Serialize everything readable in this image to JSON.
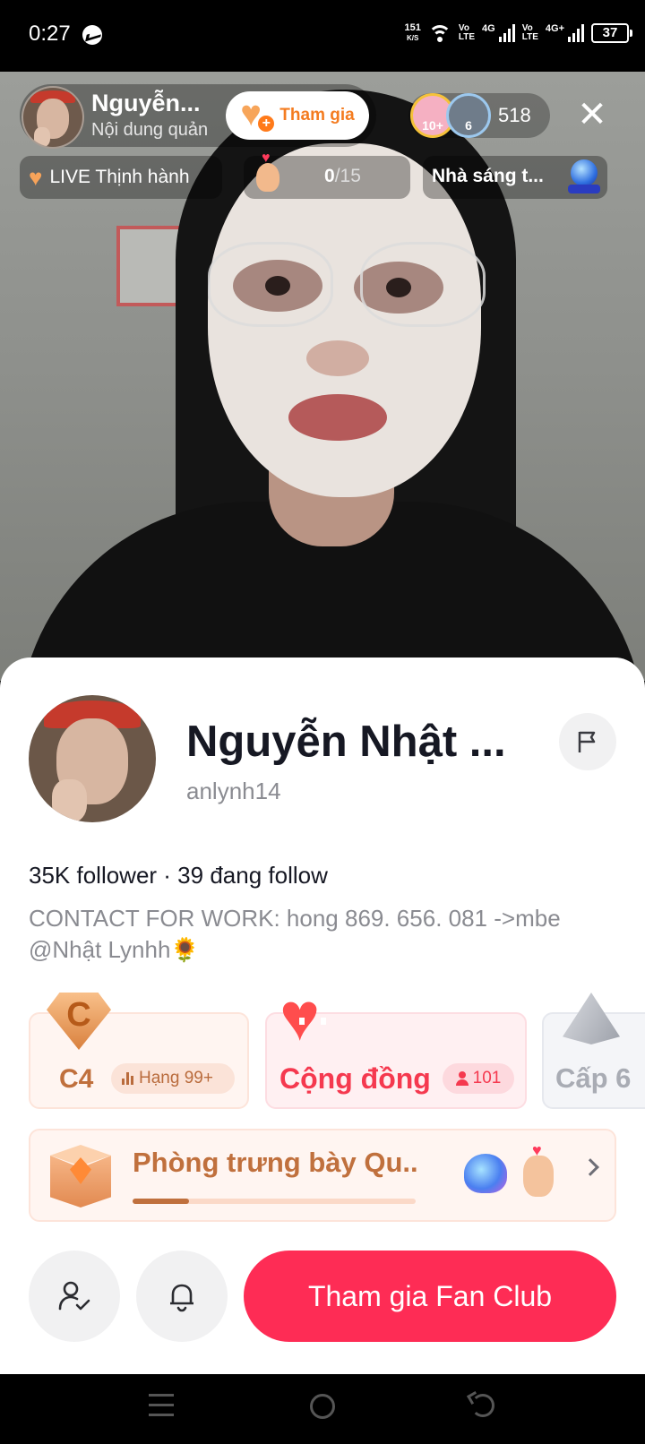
{
  "status_bar": {
    "time": "0:27",
    "net_speed_value": "151",
    "net_speed_unit": "K/S",
    "volte1_a": "Vo",
    "volte1_b": "LTE",
    "sim1_label": "4G",
    "volte2_a": "Vo",
    "volte2_b": "LTE",
    "sim2_label": "4G+",
    "battery": "37"
  },
  "live": {
    "host_name": "Nguyễn...",
    "host_subtitle": "Nội dung quản",
    "join_label": "Tham gia",
    "viewer1_badge": "10+",
    "viewer2_badge": "6",
    "viewer_count": "518",
    "trending_label": "LIVE Thịnh hành",
    "gift_done": "0",
    "gift_total": "/15",
    "creator_label": "Nhà sáng t..."
  },
  "profile": {
    "name": "Nguyễn Nhật ...",
    "username": "anlynh14",
    "follow_stats": "35K follower · 39 đang follow",
    "bio_line1": "CONTACT FOR WORK: hong 869. 656. 081 ->mbe",
    "bio_line2": "@Nhật Lynhh🌻",
    "level_badge_letter": "C",
    "level_label": "C4",
    "rank_label": "Hạng 99+",
    "community_label": "Cộng đồng",
    "member_count": "101",
    "tier_label": "Cấp 6",
    "gallery_title": "Phòng trưng bày Qu...",
    "gallery_progress_pct": 20,
    "fanclub_button": "Tham gia Fan Club"
  },
  "colors": {
    "accent": "#fe2c55",
    "community": "#f5394f",
    "level": "#c0703d",
    "join": "#f47c20"
  },
  "icons": {
    "close": "close-icon",
    "report": "flag-icon",
    "follow": "user-check-icon",
    "notify": "bell-icon"
  }
}
